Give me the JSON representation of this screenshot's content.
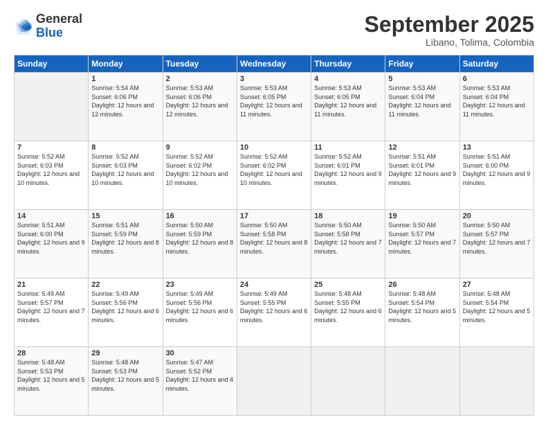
{
  "logo": {
    "general": "General",
    "blue": "Blue"
  },
  "header": {
    "month": "September 2025",
    "location": "Libano, Tolima, Colombia"
  },
  "days_of_week": [
    "Sunday",
    "Monday",
    "Tuesday",
    "Wednesday",
    "Thursday",
    "Friday",
    "Saturday"
  ],
  "weeks": [
    [
      {
        "day": "",
        "sunrise": "",
        "sunset": "",
        "daylight": ""
      },
      {
        "day": "1",
        "sunrise": "Sunrise: 5:54 AM",
        "sunset": "Sunset: 6:06 PM",
        "daylight": "Daylight: 12 hours and 12 minutes."
      },
      {
        "day": "2",
        "sunrise": "Sunrise: 5:53 AM",
        "sunset": "Sunset: 6:06 PM",
        "daylight": "Daylight: 12 hours and 12 minutes."
      },
      {
        "day": "3",
        "sunrise": "Sunrise: 5:53 AM",
        "sunset": "Sunset: 6:05 PM",
        "daylight": "Daylight: 12 hours and 11 minutes."
      },
      {
        "day": "4",
        "sunrise": "Sunrise: 5:53 AM",
        "sunset": "Sunset: 6:05 PM",
        "daylight": "Daylight: 12 hours and 11 minutes."
      },
      {
        "day": "5",
        "sunrise": "Sunrise: 5:53 AM",
        "sunset": "Sunset: 6:04 PM",
        "daylight": "Daylight: 12 hours and 11 minutes."
      },
      {
        "day": "6",
        "sunrise": "Sunrise: 5:53 AM",
        "sunset": "Sunset: 6:04 PM",
        "daylight": "Daylight: 12 hours and 11 minutes."
      }
    ],
    [
      {
        "day": "7",
        "sunrise": "Sunrise: 5:52 AM",
        "sunset": "Sunset: 6:03 PM",
        "daylight": "Daylight: 12 hours and 10 minutes."
      },
      {
        "day": "8",
        "sunrise": "Sunrise: 5:52 AM",
        "sunset": "Sunset: 6:03 PM",
        "daylight": "Daylight: 12 hours and 10 minutes."
      },
      {
        "day": "9",
        "sunrise": "Sunrise: 5:52 AM",
        "sunset": "Sunset: 6:02 PM",
        "daylight": "Daylight: 12 hours and 10 minutes."
      },
      {
        "day": "10",
        "sunrise": "Sunrise: 5:52 AM",
        "sunset": "Sunset: 6:02 PM",
        "daylight": "Daylight: 12 hours and 10 minutes."
      },
      {
        "day": "11",
        "sunrise": "Sunrise: 5:52 AM",
        "sunset": "Sunset: 6:01 PM",
        "daylight": "Daylight: 12 hours and 9 minutes."
      },
      {
        "day": "12",
        "sunrise": "Sunrise: 5:51 AM",
        "sunset": "Sunset: 6:01 PM",
        "daylight": "Daylight: 12 hours and 9 minutes."
      },
      {
        "day": "13",
        "sunrise": "Sunrise: 5:51 AM",
        "sunset": "Sunset: 6:00 PM",
        "daylight": "Daylight: 12 hours and 9 minutes."
      }
    ],
    [
      {
        "day": "14",
        "sunrise": "Sunrise: 5:51 AM",
        "sunset": "Sunset: 6:00 PM",
        "daylight": "Daylight: 12 hours and 9 minutes."
      },
      {
        "day": "15",
        "sunrise": "Sunrise: 5:51 AM",
        "sunset": "Sunset: 5:59 PM",
        "daylight": "Daylight: 12 hours and 8 minutes."
      },
      {
        "day": "16",
        "sunrise": "Sunrise: 5:50 AM",
        "sunset": "Sunset: 5:59 PM",
        "daylight": "Daylight: 12 hours and 8 minutes."
      },
      {
        "day": "17",
        "sunrise": "Sunrise: 5:50 AM",
        "sunset": "Sunset: 5:58 PM",
        "daylight": "Daylight: 12 hours and 8 minutes."
      },
      {
        "day": "18",
        "sunrise": "Sunrise: 5:50 AM",
        "sunset": "Sunset: 5:58 PM",
        "daylight": "Daylight: 12 hours and 7 minutes."
      },
      {
        "day": "19",
        "sunrise": "Sunrise: 5:50 AM",
        "sunset": "Sunset: 5:57 PM",
        "daylight": "Daylight: 12 hours and 7 minutes."
      },
      {
        "day": "20",
        "sunrise": "Sunrise: 5:50 AM",
        "sunset": "Sunset: 5:57 PM",
        "daylight": "Daylight: 12 hours and 7 minutes."
      }
    ],
    [
      {
        "day": "21",
        "sunrise": "Sunrise: 5:49 AM",
        "sunset": "Sunset: 5:57 PM",
        "daylight": "Daylight: 12 hours and 7 minutes."
      },
      {
        "day": "22",
        "sunrise": "Sunrise: 5:49 AM",
        "sunset": "Sunset: 5:56 PM",
        "daylight": "Daylight: 12 hours and 6 minutes."
      },
      {
        "day": "23",
        "sunrise": "Sunrise: 5:49 AM",
        "sunset": "Sunset: 5:56 PM",
        "daylight": "Daylight: 12 hours and 6 minutes."
      },
      {
        "day": "24",
        "sunrise": "Sunrise: 5:49 AM",
        "sunset": "Sunset: 5:55 PM",
        "daylight": "Daylight: 12 hours and 6 minutes."
      },
      {
        "day": "25",
        "sunrise": "Sunrise: 5:48 AM",
        "sunset": "Sunset: 5:55 PM",
        "daylight": "Daylight: 12 hours and 6 minutes."
      },
      {
        "day": "26",
        "sunrise": "Sunrise: 5:48 AM",
        "sunset": "Sunset: 5:54 PM",
        "daylight": "Daylight: 12 hours and 5 minutes."
      },
      {
        "day": "27",
        "sunrise": "Sunrise: 5:48 AM",
        "sunset": "Sunset: 5:54 PM",
        "daylight": "Daylight: 12 hours and 5 minutes."
      }
    ],
    [
      {
        "day": "28",
        "sunrise": "Sunrise: 5:48 AM",
        "sunset": "Sunset: 5:53 PM",
        "daylight": "Daylight: 12 hours and 5 minutes."
      },
      {
        "day": "29",
        "sunrise": "Sunrise: 5:48 AM",
        "sunset": "Sunset: 5:53 PM",
        "daylight": "Daylight: 12 hours and 5 minutes."
      },
      {
        "day": "30",
        "sunrise": "Sunrise: 5:47 AM",
        "sunset": "Sunset: 5:52 PM",
        "daylight": "Daylight: 12 hours and 4 minutes."
      },
      {
        "day": "",
        "sunrise": "",
        "sunset": "",
        "daylight": ""
      },
      {
        "day": "",
        "sunrise": "",
        "sunset": "",
        "daylight": ""
      },
      {
        "day": "",
        "sunrise": "",
        "sunset": "",
        "daylight": ""
      },
      {
        "day": "",
        "sunrise": "",
        "sunset": "",
        "daylight": ""
      }
    ]
  ]
}
